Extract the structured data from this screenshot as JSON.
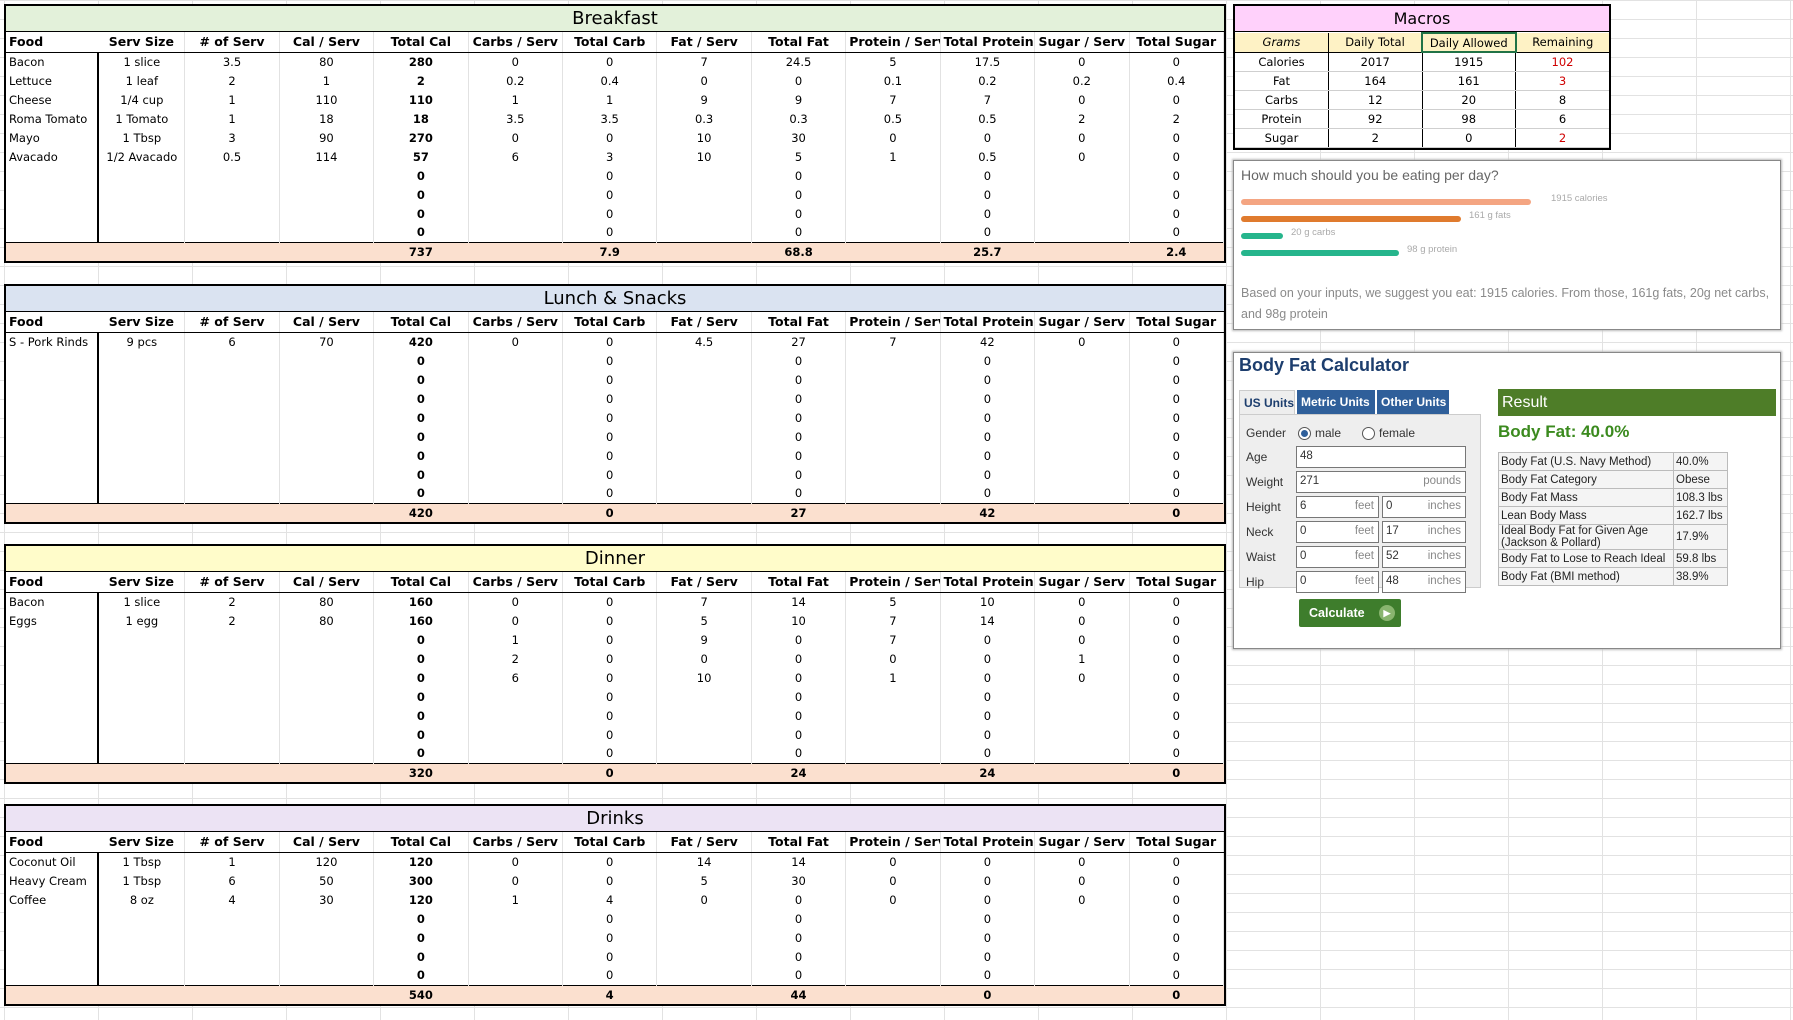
{
  "columns": [
    "Food",
    "Serv Size",
    "# of Serv",
    "Cal / Serv",
    "Total Cal",
    "Carbs / Serv",
    "Total Carb",
    "Fat / Serv",
    "Total Fat",
    "Protein / Serv",
    "Total Protein",
    "Sugar / Serv",
    "Total Sugar"
  ],
  "meals": [
    {
      "title": "Breakfast",
      "color": "#e3f1da",
      "rows": [
        [
          "Bacon",
          "1 slice",
          "3.5",
          "80",
          "280",
          "0",
          "0",
          "7",
          "24.5",
          "5",
          "17.5",
          "0",
          "0"
        ],
        [
          "Lettuce",
          "1 leaf",
          "2",
          "1",
          "2",
          "0.2",
          "0.4",
          "0",
          "0",
          "0.1",
          "0.2",
          "0.2",
          "0.4"
        ],
        [
          "Cheese",
          "1/4 cup",
          "1",
          "110",
          "110",
          "1",
          "1",
          "9",
          "9",
          "7",
          "7",
          "0",
          "0"
        ],
        [
          "Roma Tomato",
          "1 Tomato",
          "1",
          "18",
          "18",
          "3.5",
          "3.5",
          "0.3",
          "0.3",
          "0.5",
          "0.5",
          "2",
          "2"
        ],
        [
          "Mayo",
          "1 Tbsp",
          "3",
          "90",
          "270",
          "0",
          "0",
          "10",
          "30",
          "0",
          "0",
          "0",
          "0"
        ],
        [
          "Avacado",
          "1/2 Avacado",
          "0.5",
          "114",
          "57",
          "6",
          "3",
          "10",
          "5",
          "1",
          "0.5",
          "0",
          "0"
        ],
        [
          "",
          "",
          "",
          "",
          "0",
          "",
          "0",
          "",
          "0",
          "",
          "0",
          "",
          "0"
        ],
        [
          "",
          "",
          "",
          "",
          "0",
          "",
          "0",
          "",
          "0",
          "",
          "0",
          "",
          "0"
        ],
        [
          "",
          "",
          "",
          "",
          "0",
          "",
          "0",
          "",
          "0",
          "",
          "0",
          "",
          "0"
        ],
        [
          "",
          "",
          "",
          "",
          "0",
          "",
          "0",
          "",
          "0",
          "",
          "0",
          "",
          "0"
        ]
      ],
      "totals": [
        "",
        "",
        "",
        "",
        "737",
        "",
        "7.9",
        "",
        "68.8",
        "",
        "25.7",
        "",
        "2.4"
      ]
    },
    {
      "title": "Lunch & Snacks",
      "color": "#dae3f1",
      "rows": [
        [
          "S - Pork Rinds",
          "9 pcs",
          "6",
          "70",
          "420",
          "0",
          "0",
          "4.5",
          "27",
          "7",
          "42",
          "0",
          "0"
        ],
        [
          "",
          "",
          "",
          "",
          "0",
          "",
          "0",
          "",
          "0",
          "",
          "0",
          "",
          "0"
        ],
        [
          "",
          "",
          "",
          "",
          "0",
          "",
          "0",
          "",
          "0",
          "",
          "0",
          "",
          "0"
        ],
        [
          "",
          "",
          "",
          "",
          "0",
          "",
          "0",
          "",
          "0",
          "",
          "0",
          "",
          "0"
        ],
        [
          "",
          "",
          "",
          "",
          "0",
          "",
          "0",
          "",
          "0",
          "",
          "0",
          "",
          "0"
        ],
        [
          "",
          "",
          "",
          "",
          "0",
          "",
          "0",
          "",
          "0",
          "",
          "0",
          "",
          "0"
        ],
        [
          "",
          "",
          "",
          "",
          "0",
          "",
          "0",
          "",
          "0",
          "",
          "0",
          "",
          "0"
        ],
        [
          "",
          "",
          "",
          "",
          "0",
          "",
          "0",
          "",
          "0",
          "",
          "0",
          "",
          "0"
        ],
        [
          "",
          "",
          "",
          "",
          "0",
          "",
          "0",
          "",
          "0",
          "",
          "0",
          "",
          "0"
        ]
      ],
      "totals": [
        "",
        "",
        "",
        "",
        "420",
        "",
        "0",
        "",
        "27",
        "",
        "42",
        "",
        "0"
      ]
    },
    {
      "title": "Dinner",
      "color": "#fffcca",
      "rows": [
        [
          "Bacon",
          "1 slice",
          "2",
          "80",
          "160",
          "0",
          "0",
          "7",
          "14",
          "5",
          "10",
          "0",
          "0"
        ],
        [
          "Eggs",
          "1 egg",
          "2",
          "80",
          "160",
          "0",
          "0",
          "5",
          "10",
          "7",
          "14",
          "0",
          "0"
        ],
        [
          "",
          "",
          "",
          "",
          "0",
          "1",
          "0",
          "9",
          "0",
          "7",
          "0",
          "0",
          "0"
        ],
        [
          "",
          "",
          "",
          "",
          "0",
          "2",
          "0",
          "0",
          "0",
          "0",
          "0",
          "1",
          "0"
        ],
        [
          "",
          "",
          "",
          "",
          "0",
          "6",
          "0",
          "10",
          "0",
          "1",
          "0",
          "0",
          "0"
        ],
        [
          "",
          "",
          "",
          "",
          "0",
          "",
          "0",
          "",
          "0",
          "",
          "0",
          "",
          "0"
        ],
        [
          "",
          "",
          "",
          "",
          "0",
          "",
          "0",
          "",
          "0",
          "",
          "0",
          "",
          "0"
        ],
        [
          "",
          "",
          "",
          "",
          "0",
          "",
          "0",
          "",
          "0",
          "",
          "0",
          "",
          "0"
        ],
        [
          "",
          "",
          "",
          "",
          "0",
          "",
          "0",
          "",
          "0",
          "",
          "0",
          "",
          "0"
        ]
      ],
      "totals": [
        "",
        "",
        "",
        "",
        "320",
        "",
        "0",
        "",
        "24",
        "",
        "24",
        "",
        "0"
      ]
    },
    {
      "title": "Drinks",
      "color": "#ece3f4",
      "rows": [
        [
          "Coconut Oil",
          "1 Tbsp",
          "1",
          "120",
          "120",
          "0",
          "0",
          "14",
          "14",
          "0",
          "0",
          "0",
          "0"
        ],
        [
          "Heavy Cream",
          "1 Tbsp",
          "6",
          "50",
          "300",
          "0",
          "0",
          "5",
          "30",
          "0",
          "0",
          "0",
          "0"
        ],
        [
          "Coffee",
          "8 oz",
          "4",
          "30",
          "120",
          "1",
          "4",
          "0",
          "0",
          "0",
          "0",
          "0",
          "0"
        ],
        [
          "",
          "",
          "",
          "",
          "0",
          "",
          "0",
          "",
          "0",
          "",
          "0",
          "",
          "0"
        ],
        [
          "",
          "",
          "",
          "",
          "0",
          "",
          "0",
          "",
          "0",
          "",
          "0",
          "",
          "0"
        ],
        [
          "",
          "",
          "",
          "",
          "0",
          "",
          "0",
          "",
          "0",
          "",
          "0",
          "",
          "0"
        ],
        [
          "",
          "",
          "",
          "",
          "0",
          "",
          "0",
          "",
          "0",
          "",
          "0",
          "",
          "0"
        ]
      ],
      "totals": [
        "",
        "",
        "",
        "",
        "540",
        "",
        "4",
        "",
        "44",
        "",
        "0",
        "",
        "0"
      ]
    }
  ],
  "macros": {
    "title": "Macros",
    "headers": [
      "Grams",
      "Daily Total",
      "Daily Allowed",
      "Remaining"
    ],
    "rows": [
      [
        "Calories",
        "2017",
        "1915",
        "102"
      ],
      [
        "Fat",
        "164",
        "161",
        "3"
      ],
      [
        "Carbs",
        "12",
        "20",
        "8"
      ],
      [
        "Protein",
        "92",
        "98",
        "6"
      ],
      [
        "Sugar",
        "2",
        "0",
        "2"
      ]
    ],
    "red_remaining": [
      true,
      true,
      false,
      false,
      true
    ]
  },
  "suggest": {
    "question": "How much should you be eating per day?",
    "bars": [
      {
        "label": "1915 calories",
        "value": 1915,
        "color": "#f4a582"
      },
      {
        "label": "161 g fats",
        "value": 161,
        "color": "#e07b2e"
      },
      {
        "label": "20 g carbs",
        "value": 20,
        "color": "#26b58c"
      },
      {
        "label": "98 g protein",
        "value": 98,
        "color": "#26b58c"
      }
    ],
    "text": "Based on your inputs, we suggest you eat: 1915 calories. From those, 161g fats, 20g net carbs, and 98g protein"
  },
  "bfc": {
    "title": "Body Fat Calculator",
    "tabs": [
      "US Units",
      "Metric Units",
      "Other Units"
    ],
    "labels": {
      "gender": "Gender",
      "age": "Age",
      "weight": "Weight",
      "height": "Height",
      "neck": "Neck",
      "waist": "Waist",
      "hip": "Hip"
    },
    "gender_options": [
      "male",
      "female"
    ],
    "age": "48",
    "weight": "271",
    "weight_unit": "pounds",
    "height_ft": "6",
    "height_in": "0",
    "neck_ft": "0",
    "neck_in": "17",
    "waist_ft": "0",
    "waist_in": "52",
    "hip_ft": "0",
    "hip_in": "48",
    "unit_ft": "feet",
    "unit_in": "inches",
    "calculate": "Calculate",
    "result_header": "Result",
    "result_big": "Body Fat: 40.0%",
    "result_rows": [
      [
        "Body Fat (U.S. Navy Method)",
        "40.0%"
      ],
      [
        "Body Fat Category",
        "Obese"
      ],
      [
        "Body Fat Mass",
        "108.3 lbs"
      ],
      [
        "Lean Body Mass",
        "162.7 lbs"
      ],
      [
        "Ideal Body Fat for Given Age (Jackson & Pollard)",
        "17.9%"
      ],
      [
        "Body Fat to Lose to Reach Ideal",
        "59.8 lbs"
      ],
      [
        "Body Fat (BMI method)",
        "38.9%"
      ]
    ]
  }
}
